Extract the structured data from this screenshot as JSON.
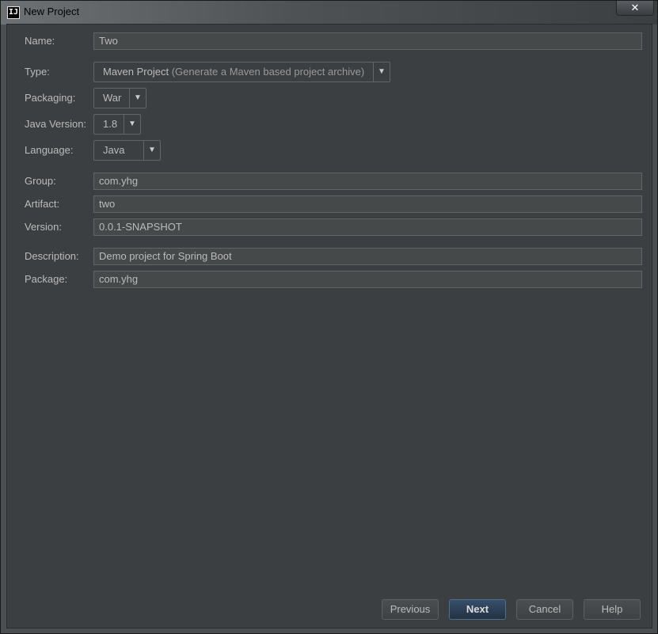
{
  "window": {
    "title": "New Project",
    "app_icon": "IJ",
    "close_label": "✕"
  },
  "form": {
    "name": {
      "label": "Name:",
      "value": "Two"
    },
    "type": {
      "label": "Type:",
      "value": "Maven Project",
      "hint": "(Generate a Maven based project archive)"
    },
    "packaging": {
      "label": "Packaging:",
      "value": "War"
    },
    "java_version": {
      "label": "Java Version:",
      "value": "1.8"
    },
    "language": {
      "label": "Language:",
      "value": "Java"
    },
    "group": {
      "label": "Group:",
      "value": "com.yhg"
    },
    "artifact": {
      "label": "Artifact:",
      "value": "two"
    },
    "version": {
      "label": "Version:",
      "value": "0.0.1-SNAPSHOT"
    },
    "description": {
      "label": "Description:",
      "value": "Demo project for Spring Boot"
    },
    "package": {
      "label": "Package:",
      "value": "com.yhg"
    }
  },
  "buttons": {
    "previous": "Previous",
    "next": "Next",
    "cancel": "Cancel",
    "help": "Help"
  },
  "icons": {
    "dropdown": "chevron-down-icon",
    "close": "close-icon",
    "app": "intellij-icon"
  }
}
